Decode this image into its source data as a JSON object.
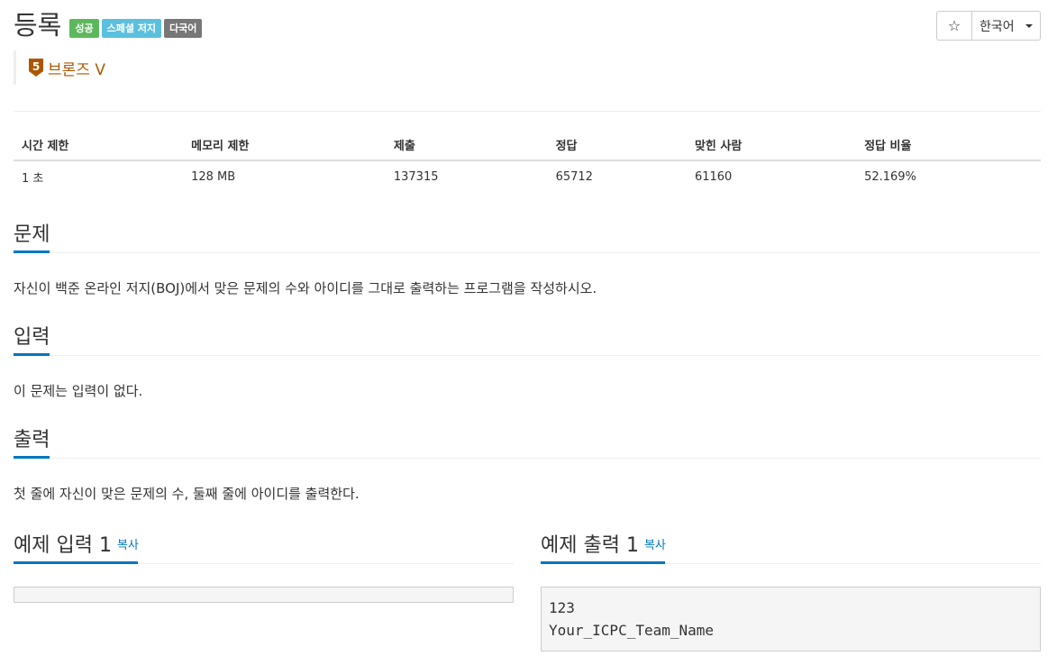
{
  "problem": {
    "title": "등록",
    "badges": [
      "성공",
      "스페셜 저지",
      "다국어"
    ],
    "tier": "브론즈 V",
    "tier_level": "5"
  },
  "toolbar": {
    "star_icon": "☆",
    "language": "한국어"
  },
  "info_table": {
    "headers": [
      "시간 제한",
      "메모리 제한",
      "제출",
      "정답",
      "맞힌 사람",
      "정답 비율"
    ],
    "values": [
      "1 초",
      "128 MB",
      "137315",
      "65712",
      "61160",
      "52.169%"
    ]
  },
  "sections": {
    "description": {
      "title": "문제",
      "body": "자신이 백준 온라인 저지(BOJ)에서 맞은 문제의 수와 아이디를 그대로 출력하는 프로그램을 작성하시오."
    },
    "input": {
      "title": "입력",
      "body": "이 문제는 입력이 없다."
    },
    "output": {
      "title": "출력",
      "body": "첫 줄에 자신이 맞은 문제의 수, 둘째 줄에 아이디를 출력한다."
    }
  },
  "samples": {
    "input": {
      "title": "예제 입력 1",
      "copy_label": "복사",
      "content": ""
    },
    "output": {
      "title": "예제 출력 1",
      "copy_label": "복사",
      "content": "123\nYour_ICPC_Team_Name"
    }
  },
  "colors": {
    "accent": "#0076c0",
    "tier": "#ad5600",
    "success": "#5cb85c",
    "info": "#5bc0de",
    "default": "#777777"
  }
}
